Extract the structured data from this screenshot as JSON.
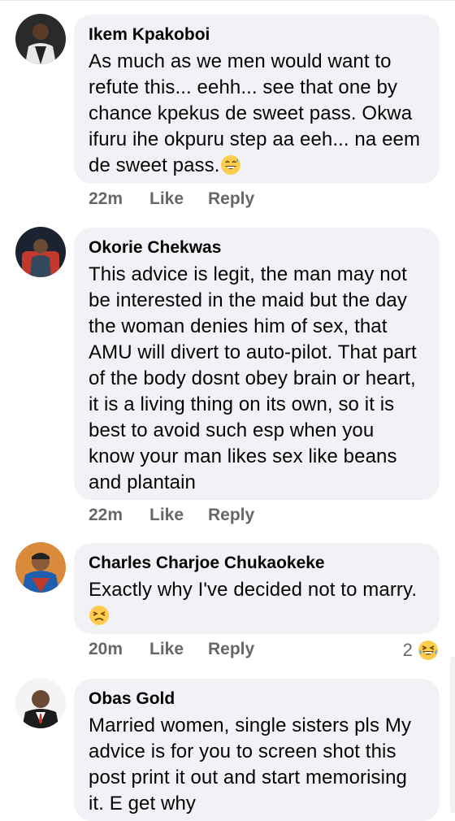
{
  "comments": [
    {
      "author": "Ikem Kpakoboi",
      "text": "As much as we men would want to refute this... eehh... see that one by chance kpekus de sweet pass. Okwa ifuru ihe okpuru step aa eeh... na eem de sweet pass.",
      "emoji": "grinning-sweat-emoji",
      "time": "22m",
      "like": "Like",
      "reply": "Reply"
    },
    {
      "author": "Okorie Chekwas",
      "text": "This advice is legit, the man may not be interested in the maid but the day the woman denies him of sex, that AMU will divert to auto-pilot. That part of the body dosnt obey brain or heart, it is a living thing on its own, so it is best to avoid such esp when you know your man likes sex like beans and plantain",
      "time": "22m",
      "like": "Like",
      "reply": "Reply"
    },
    {
      "author": "Charles Charjoe Chukaokeke",
      "text": "Exactly why I've decided not to marry.",
      "emoji": "persevering-face-emoji",
      "time": "20m",
      "like": "Like",
      "reply": "Reply",
      "reaction_count": "2",
      "reaction_emoji": "laughing-emoji"
    },
    {
      "author": "Obas Gold",
      "text": "Married women, single sisters pls My advice is for you to screen shot this post print it out and start memorising it. E get why"
    }
  ],
  "colors": {
    "bubble": "#f0f2f5",
    "meta_text": "#65676b",
    "emoji_yellow": "#ffcc4d"
  }
}
